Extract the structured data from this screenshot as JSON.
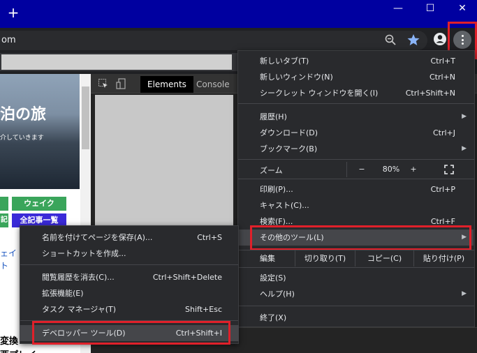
{
  "window": {
    "new_tab_glyph": "+",
    "minimize_glyph": "—",
    "maximize_glyph": "☐",
    "close_glyph": "✕"
  },
  "address": {
    "url_fragment": "om"
  },
  "page": {
    "hero_title": "泊の旅",
    "hero_subtitle": "介していきます",
    "tags": [
      "ウェイク",
      "記",
      "全記事一覧"
    ],
    "text_fragment_1": "ェイ",
    "text_fragment_2": "ト",
    "text_fragment_3": "変換",
    "text_fragment_4": "西プレイ"
  },
  "devtools": {
    "tabs": [
      "Elements",
      "Console"
    ]
  },
  "menu": {
    "items_top": [
      {
        "label": "新しいタブ(T)",
        "shortcut": "Ctrl+T"
      },
      {
        "label": "新しいウィンドウ(N)",
        "shortcut": "Ctrl+N"
      },
      {
        "label": "シークレット ウィンドウを開く(I)",
        "shortcut": "Ctrl+Shift+N"
      }
    ],
    "items_history": [
      {
        "label": "履歴(H)",
        "shortcut": ""
      },
      {
        "label": "ダウンロード(D)",
        "shortcut": "Ctrl+J"
      },
      {
        "label": "ブックマーク(B)",
        "shortcut": ""
      }
    ],
    "zoom": {
      "label": "ズーム",
      "minus": "−",
      "value": "80%",
      "plus": "+"
    },
    "items_print": [
      {
        "label": "印刷(P)...",
        "shortcut": "Ctrl+P"
      },
      {
        "label": "キャスト(C)...",
        "shortcut": ""
      },
      {
        "label": "検索(F)...",
        "shortcut": "Ctrl+F"
      },
      {
        "label": "その他のツール(L)",
        "shortcut": ""
      }
    ],
    "edit": {
      "label": "編集",
      "cut": "切り取り(T)",
      "copy": "コピー(C)",
      "paste": "貼り付け(P)"
    },
    "items_settings": [
      {
        "label": "設定(S)",
        "shortcut": ""
      },
      {
        "label": "ヘルプ(H)",
        "shortcut": ""
      }
    ],
    "exit": {
      "label": "終了(X)"
    }
  },
  "submenu": {
    "items_a": [
      {
        "label": "名前を付けてページを保存(A)...",
        "shortcut": "Ctrl+S"
      },
      {
        "label": "ショートカットを作成...",
        "shortcut": ""
      }
    ],
    "items_b": [
      {
        "label": "閲覧履歴を消去(C)...",
        "shortcut": "Ctrl+Shift+Delete"
      },
      {
        "label": "拡張機能(E)",
        "shortcut": ""
      },
      {
        "label": "タスク マネージャ(T)",
        "shortcut": "Shift+Esc"
      }
    ],
    "devtools": {
      "label": "デベロッパー ツール(D)",
      "shortcut": "Ctrl+Shift+I"
    }
  },
  "colors": {
    "titlebar": "#0000a0",
    "highlight": "#e0202a",
    "tag_green": "#3aa55b",
    "tag_blue": "#3a2ad8"
  }
}
